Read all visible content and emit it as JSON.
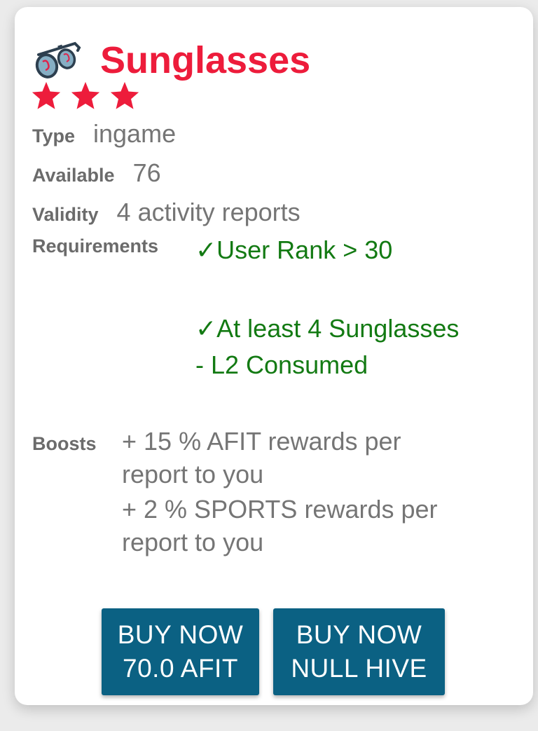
{
  "item": {
    "icon": "sunglasses-icon",
    "name": "Sunglasses",
    "rating_stars": 3,
    "star_icon": "star-icon"
  },
  "colors": {
    "title": "#ed1c3b",
    "star": "#ed1c3b",
    "requirement_met": "#137a13",
    "button_bg": "#0b6183",
    "label": "#6b6b6b",
    "value": "#757575"
  },
  "details": {
    "type_label": "Type",
    "type_value": "ingame",
    "available_label": "Available",
    "available_value": "76",
    "validity_label": "Validity",
    "validity_value": "4 activity reports",
    "requirements_label": "Requirements",
    "requirements": [
      {
        "text": "✓User Rank > 30"
      },
      {
        "line1": "✓At least 4 Sunglasses",
        "line2": "- L2 Consumed"
      }
    ],
    "boosts_label": "Boosts",
    "boosts": [
      {
        "line1": "+ 15 % AFIT rewards per",
        "line2": "report to you"
      },
      {
        "line1": "+ 2 % SPORTS rewards per",
        "line2": "report to you"
      }
    ]
  },
  "buttons": [
    {
      "line1": "BUY NOW",
      "line2": "70.0 AFIT"
    },
    {
      "line1": "BUY NOW",
      "line2": "NULL HIVE"
    }
  ]
}
